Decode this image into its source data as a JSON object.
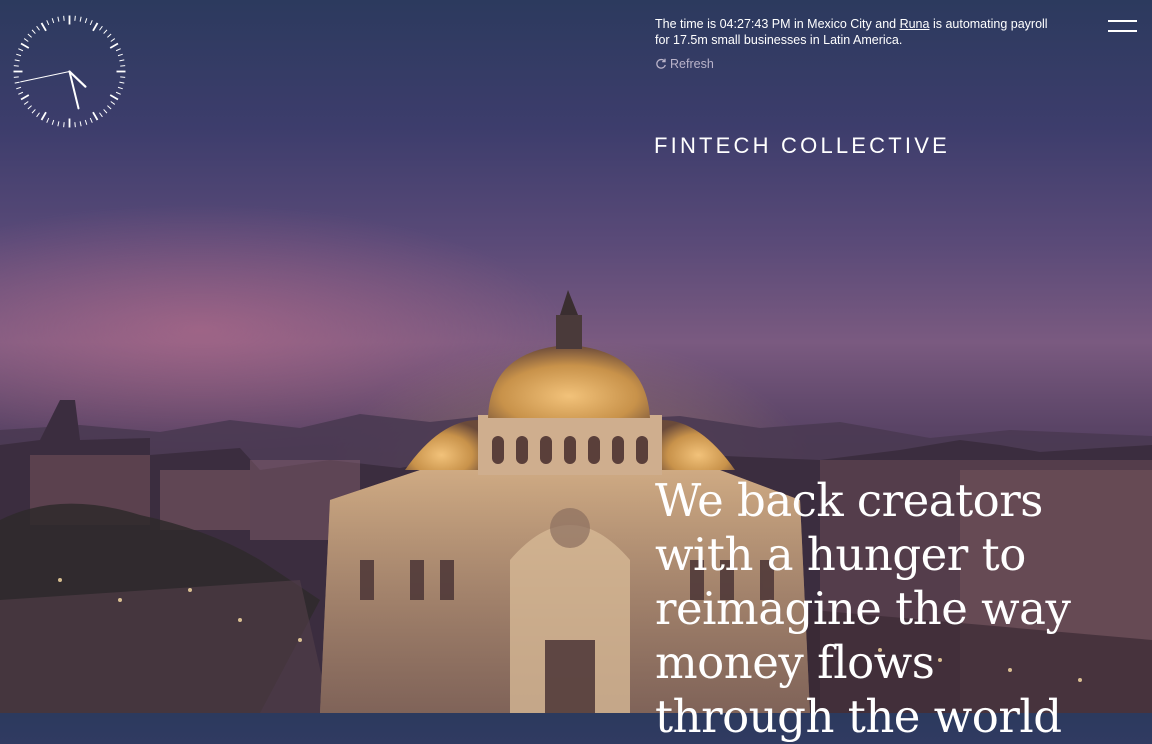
{
  "clock": {
    "label": "analog-clock",
    "hours": 4,
    "minutes": 27,
    "seconds": 43
  },
  "status": {
    "prefix": "The time is ",
    "time": "04:27:43 PM",
    "middle": " in Mexico City and ",
    "company_link": "Runa",
    "suffix": " is automating payroll for 17.5m small businesses in Latin America."
  },
  "refresh": {
    "label": "Refresh",
    "icon": "refresh-icon"
  },
  "menu": {
    "icon": "hamburger-menu-icon"
  },
  "brand": {
    "name": "FINTECH COLLECTIVE"
  },
  "hero": {
    "headline": "We back creators with a hunger to reimagine the way money flows through the world",
    "image_subject": "Palacio de Bellas Artes, Mexico City, at dusk"
  },
  "colors": {
    "text": "#ffffff",
    "muted": "#b9b3c9",
    "dome_gold": "#c8924a",
    "sky_top": "#2c3a5e",
    "sky_mid": "#7a5a80"
  }
}
